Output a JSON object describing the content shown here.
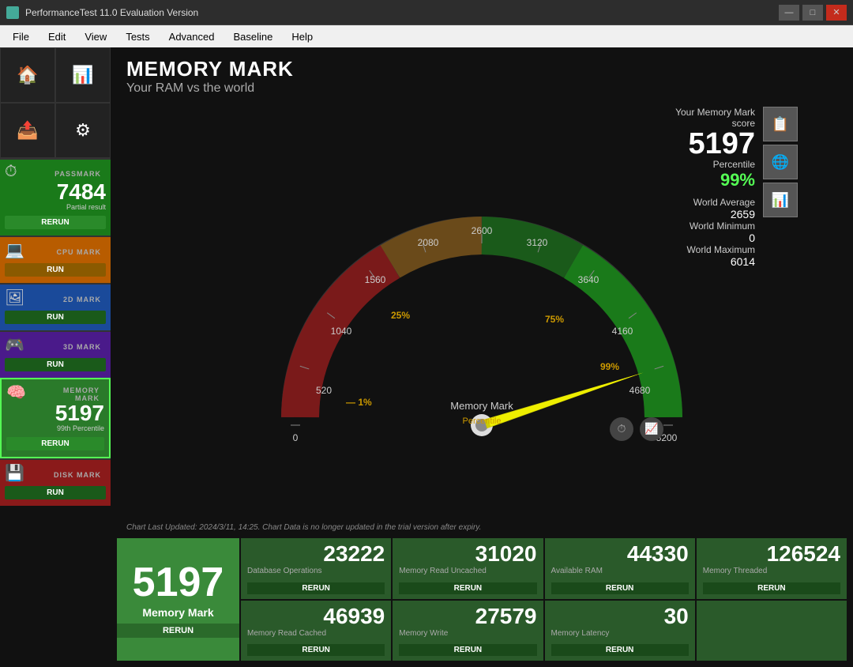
{
  "titlebar": {
    "icon": "PT",
    "title": "PerformanceTest 11.0 Evaluation Version",
    "minimize": "—",
    "maximize": "□",
    "close": "✕"
  },
  "menubar": {
    "items": [
      "File",
      "Edit",
      "View",
      "Tests",
      "Advanced",
      "Baseline",
      "Help"
    ]
  },
  "sidebar": {
    "home_icon": "🏠",
    "monitor_icon": "📊",
    "upload_icon": "📤",
    "gear_icon": "⚙",
    "sections": [
      {
        "id": "passmark",
        "label": "PASSMARK",
        "score": "7484",
        "sub": "Partial result",
        "btn": "RERUN",
        "btn_class": "green"
      },
      {
        "id": "cpumark",
        "label": "CPU MARK",
        "score": "",
        "sub": "",
        "btn": "RUN",
        "btn_class": "orange"
      },
      {
        "id": "2dmark",
        "label": "2D MARK",
        "score": "",
        "sub": "",
        "btn": "RUN",
        "btn_class": "run"
      },
      {
        "id": "3dmark",
        "label": "3D MARK",
        "score": "",
        "sub": "",
        "btn": "RUN",
        "btn_class": "run"
      },
      {
        "id": "memmark",
        "label": "MEMORY MARK",
        "score": "5197",
        "sub": "99th Percentile",
        "btn": "RERUN",
        "btn_class": "green",
        "active": true
      },
      {
        "id": "diskmark",
        "label": "DISK MARK",
        "score": "",
        "sub": "",
        "btn": "RUN",
        "btn_class": "run"
      }
    ]
  },
  "content": {
    "title": "MEMORY MARK",
    "subtitle": "Your RAM vs the world",
    "chart_notice": "Chart Last Updated: 2024/3/11, 14:25. Chart Data is no longer updated in the trial version after expiry.",
    "score_panel": {
      "label": "Your Memory Mark score",
      "score": "5197",
      "percentile_label": "Percentile",
      "percentile": "99%",
      "world_average_label": "World Average",
      "world_average": "2659",
      "world_min_label": "World Minimum",
      "world_min": "0",
      "world_max_label": "World Maximum",
      "world_max": "6014"
    },
    "gauge": {
      "scale_labels": [
        "0",
        "520",
        "1040",
        "1560",
        "2080",
        "2600",
        "3120",
        "3640",
        "4160",
        "4680",
        "5200"
      ],
      "percentile_markers": [
        {
          "label": "1%",
          "angle": -170
        },
        {
          "label": "25%",
          "angle": -120
        },
        {
          "label": "75%",
          "angle": -30
        },
        {
          "label": "99%",
          "angle": 30
        }
      ],
      "title": "Memory Mark",
      "subtitle": "Percentile"
    },
    "tiles": {
      "main": {
        "score": "5197",
        "label": "Memory Mark",
        "rerun": "RERUN"
      },
      "subtests": [
        {
          "score": "23222",
          "name": "Database Operations",
          "rerun": "RERUN"
        },
        {
          "score": "31020",
          "name": "Memory Read Uncached",
          "rerun": "RERUN"
        },
        {
          "score": "44330",
          "name": "Available RAM",
          "rerun": "RERUN"
        },
        {
          "score": "126524",
          "name": "Memory Threaded",
          "rerun": "RERUN"
        },
        {
          "score": "46939",
          "name": "Memory Read Cached",
          "rerun": "RERUN"
        },
        {
          "score": "27579",
          "name": "Memory Write",
          "rerun": "RERUN"
        },
        {
          "score": "30",
          "name": "Memory Latency",
          "rerun": "RERUN"
        },
        {
          "score": "",
          "name": "",
          "rerun": ""
        }
      ]
    }
  }
}
